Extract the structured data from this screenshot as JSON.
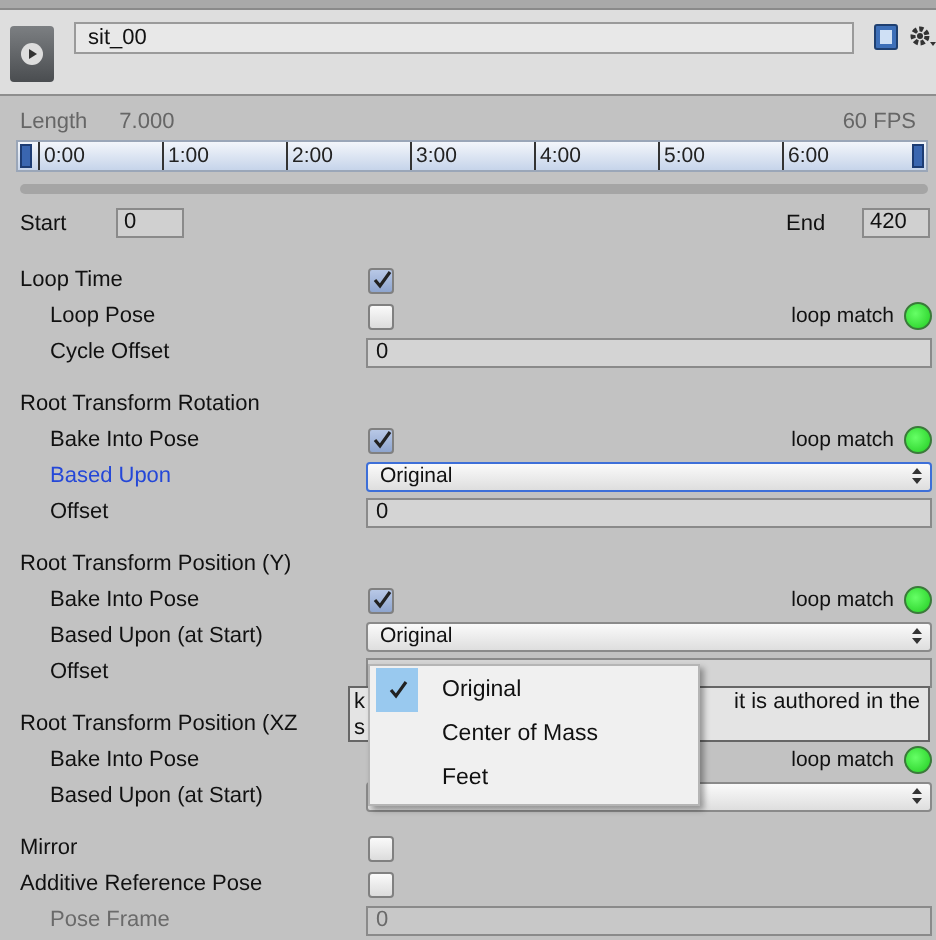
{
  "header": {
    "clip_name": "sit_00"
  },
  "length": {
    "label": "Length",
    "value": "7.000",
    "fps": "60 FPS"
  },
  "timeline": {
    "ticks": [
      "0:00",
      "1:00",
      "2:00",
      "3:00",
      "4:00",
      "5:00",
      "6:00"
    ]
  },
  "range": {
    "start_label": "Start",
    "start": "0",
    "end_label": "End",
    "end": "420"
  },
  "groups": [
    [
      {
        "kind": "checkbox",
        "label": "Loop Time",
        "checked": true,
        "children": [
          {
            "kind": "checkbox",
            "label": "Loop Pose",
            "checked": false,
            "loop_match": "loop match"
          },
          {
            "kind": "field",
            "label": "Cycle Offset",
            "value": "0",
            "disabled": false
          }
        ]
      }
    ],
    [
      {
        "kind": "heading",
        "label": "Root Transform Rotation",
        "children": [
          {
            "kind": "checkbox",
            "label": "Bake Into Pose",
            "checked": true,
            "loop_match": "loop match"
          },
          {
            "kind": "dropdown",
            "label": "Based Upon",
            "value": "Original",
            "focused": true
          },
          {
            "kind": "field",
            "label": "Offset",
            "value": "0",
            "disabled": false
          }
        ]
      }
    ],
    [
      {
        "kind": "heading",
        "label": "Root Transform Position (Y)",
        "children": [
          {
            "kind": "checkbox",
            "label": "Bake Into Pose",
            "checked": true,
            "loop_match": "loop match"
          },
          {
            "kind": "dropdown",
            "label": "Based Upon (at Start)",
            "value": "Original",
            "focused": false
          },
          {
            "kind": "field",
            "label": "Offset",
            "disabled": false
          }
        ]
      }
    ],
    [
      {
        "kind": "heading",
        "label": "Root Transform Position (XZ",
        "children": [
          {
            "kind": "checkbox",
            "label": "Bake Into Pose",
            "loop_match": "loop match"
          },
          {
            "kind": "dropdown",
            "label": "Based Upon (at Start)",
            "focused": false
          }
        ]
      }
    ],
    [
      {
        "kind": "checkbox",
        "label": "Mirror",
        "checked": false
      },
      {
        "kind": "checkbox",
        "label": "Additive Reference Pose",
        "checked": false,
        "children": [
          {
            "kind": "field",
            "label": "Pose Frame",
            "value": "0",
            "disabled": true
          }
        ]
      }
    ]
  ],
  "tooltip": {
    "left_lines": [
      "k",
      "s"
    ],
    "right_text": "it is authored in the"
  },
  "popup": {
    "options": [
      {
        "label": "Original",
        "selected": true
      },
      {
        "label": "Center of Mass",
        "selected": false
      },
      {
        "label": "Feet",
        "selected": false
      }
    ]
  }
}
